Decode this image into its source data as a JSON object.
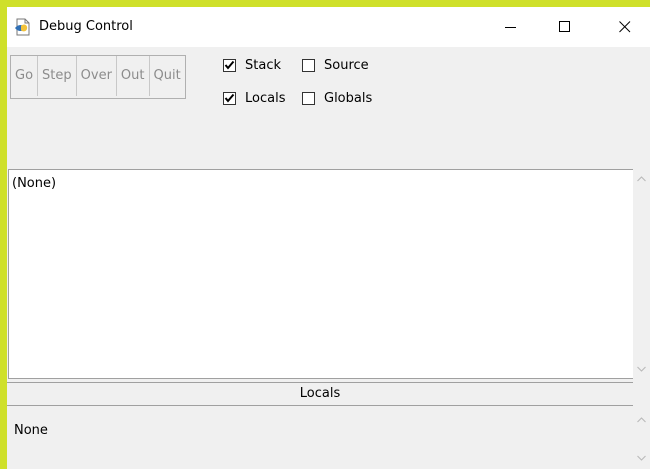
{
  "window": {
    "title": "Debug Control"
  },
  "toolbar": {
    "buttons": [
      {
        "label": "Go"
      },
      {
        "label": "Step"
      },
      {
        "label": "Over"
      },
      {
        "label": "Out"
      },
      {
        "label": "Quit"
      }
    ]
  },
  "options": {
    "stack": {
      "label": "Stack",
      "checked": true
    },
    "source": {
      "label": "Source",
      "checked": false
    },
    "locals": {
      "label": "Locals",
      "checked": true
    },
    "globals": {
      "label": "Globals",
      "checked": false
    }
  },
  "stack_pane": {
    "text": "(None)"
  },
  "locals_section": {
    "header": "Locals",
    "text": "None"
  },
  "icons": [
    "app-icon",
    "minimize-icon",
    "maximize-icon",
    "close-icon",
    "checkmark-icon",
    "scroll-up-arrow-icon",
    "scroll-down-arrow-icon"
  ]
}
